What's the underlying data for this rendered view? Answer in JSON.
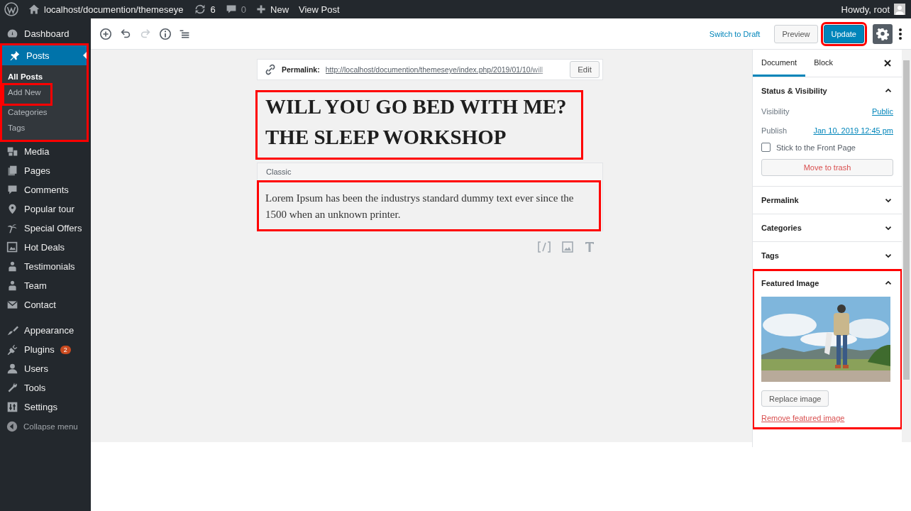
{
  "admin_bar": {
    "site": "localhost/documention/themeseye",
    "updates": "6",
    "comments": "0",
    "new": "New",
    "view": "View Post",
    "greeting": "Howdy, root"
  },
  "menu": {
    "groups": [
      [
        {
          "label": "Dashboard",
          "selected": false,
          "highlighted": false
        },
        {
          "label": "Posts",
          "selected": true,
          "highlighted": true,
          "children": [
            {
              "label": "All Posts",
              "selected": true,
              "highlighted": false
            },
            {
              "label": "Add New",
              "selected": false,
              "highlighted": true
            },
            {
              "label": "Categories",
              "selected": false,
              "highlighted": false
            },
            {
              "label": "Tags",
              "selected": false,
              "highlighted": false
            }
          ]
        },
        {
          "label": "Media",
          "selected": false,
          "highlighted": false
        },
        {
          "label": "Pages",
          "selected": false,
          "highlighted": false
        },
        {
          "label": "Comments",
          "selected": false,
          "highlighted": false
        },
        {
          "label": "Popular tour",
          "selected": false,
          "highlighted": false
        },
        {
          "label": "Special Offers",
          "selected": false,
          "highlighted": false
        },
        {
          "label": "Hot Deals",
          "selected": false,
          "highlighted": false
        },
        {
          "label": "Testimonials",
          "selected": false,
          "highlighted": false
        },
        {
          "label": "Team",
          "selected": false,
          "highlighted": false
        },
        {
          "label": "Contact",
          "selected": false,
          "highlighted": false
        }
      ],
      [
        {
          "label": "Appearance",
          "selected": false,
          "highlighted": false
        },
        {
          "label": "Plugins",
          "selected": false,
          "highlighted": false,
          "badge": "2"
        },
        {
          "label": "Users",
          "selected": false,
          "highlighted": false
        },
        {
          "label": "Tools",
          "selected": false,
          "highlighted": false
        },
        {
          "label": "Settings",
          "selected": false,
          "highlighted": false
        }
      ]
    ],
    "collapse": "Collapse menu"
  },
  "toolbar": {
    "redo_disabled": true,
    "switch_draft": "Switch to Draft",
    "preview": "Preview",
    "update": "Update",
    "update_highlighted": true,
    "settings_on": true
  },
  "post": {
    "permalink_label": "Permalink:",
    "permalink": "http://localhost/documention/themeseye/index.php/2019/01/10/will",
    "edit": "Edit",
    "title": "WILL YOU GO BED WITH ME? THE SLEEP WORKSHOP",
    "title_highlighted": true,
    "block_label": "Classic",
    "paragraph": "Lorem Ipsum has been the industrys standard dummy text ever since the 1500 when an unknown printer.",
    "paragraph_highlighted": true
  },
  "panel": {
    "tabs": [
      {
        "label": "Document",
        "selected": true
      },
      {
        "label": "Block",
        "selected": false
      }
    ],
    "sections": [
      {
        "title": "Status & Visibility",
        "kind": "status",
        "expanded": true,
        "highlighted": false,
        "visibility_label": "Visibility",
        "visibility": "Public",
        "publish_label": "Publish",
        "publish": "Jan 10, 2019 12:45 pm",
        "sticky_label": "Stick to the Front Page",
        "sticky_checked": false,
        "trash": "Move to trash"
      },
      {
        "title": "Permalink",
        "expanded": false,
        "highlighted": false
      },
      {
        "title": "Categories",
        "expanded": false,
        "highlighted": false
      },
      {
        "title": "Tags",
        "expanded": false,
        "highlighted": false
      },
      {
        "title": "Featured Image",
        "kind": "featured",
        "expanded": true,
        "highlighted": true,
        "replace": "Replace image",
        "remove": "Remove featured image"
      }
    ]
  }
}
